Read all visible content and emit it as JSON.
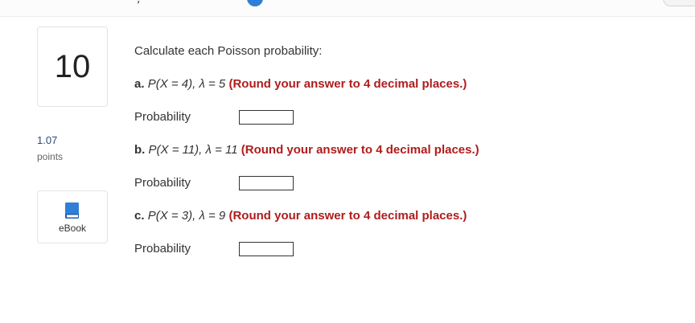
{
  "question": {
    "number": "10",
    "points_value": "1.07",
    "points_label": "points",
    "ebook_label": "eBook",
    "intro": "Calculate each Poisson probability:",
    "parts": [
      {
        "label": "a.",
        "expression": "P(X = 4), λ = 5",
        "instruction": "(Round your answer to 4 decimal places.)",
        "answer_label": "Probability",
        "answer_value": ""
      },
      {
        "label": "b.",
        "expression": "P(X = 11), λ = 11",
        "instruction": "(Round your answer to 4 decimal places.)",
        "answer_label": "Probability",
        "answer_value": ""
      },
      {
        "label": "c.",
        "expression": "P(X = 3), λ = 9",
        "instruction": "(Round your answer to 4 decimal places.)",
        "answer_label": "Probability",
        "answer_value": ""
      }
    ]
  },
  "colors": {
    "instruction_red": "#b01c1c",
    "points_blue": "#2a4b78",
    "ebook_icon_blue": "#2f7fd6"
  },
  "icons": {
    "ebook": "book-icon"
  }
}
